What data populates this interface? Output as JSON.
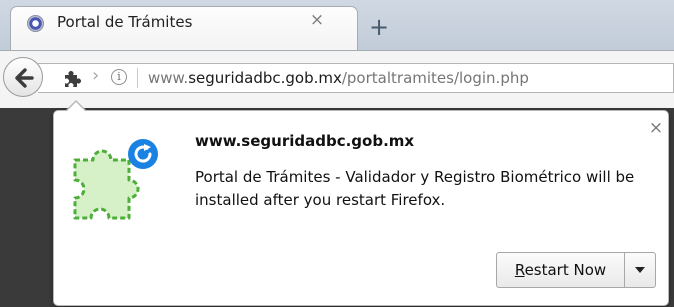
{
  "tab": {
    "title": "Portal de Trámites",
    "close_glyph": "×",
    "favicon": "site-seal-icon"
  },
  "new_tab_glyph": "+",
  "navbar": {
    "back_icon": "back-arrow-icon",
    "addon_icon": "puzzle-piece-icon",
    "chevron_glyph": "›",
    "info_glyph": "i",
    "url": {
      "prefix": "www.",
      "domain": "seguridadbc.gob.mx",
      "path": "/portaltramites/login.php"
    }
  },
  "popup": {
    "icon": "addon-restart-icon",
    "heading": "www.seguridadbc.gob.mx",
    "message": "Portal de Trámites - Validador y Registro Biométrico will be installed after you restart Firefox.",
    "close_glyph": "×",
    "restart_button": {
      "label_first": "R",
      "label_rest": "estart Now"
    }
  },
  "colors": {
    "accent": "#1a82e2",
    "puzzle_fill": "#d6f0c8",
    "puzzle_stroke": "#4fae3a"
  }
}
